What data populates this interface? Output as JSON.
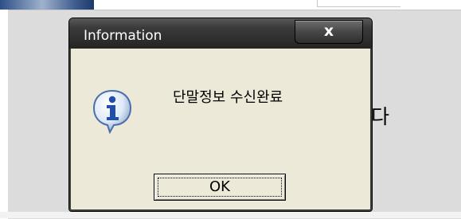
{
  "background": {
    "text": "다"
  },
  "dialog": {
    "title": "Information",
    "close_icon": "x",
    "icon": "information-icon",
    "message": "단말정보 수신완료",
    "ok_label": "OK"
  }
}
